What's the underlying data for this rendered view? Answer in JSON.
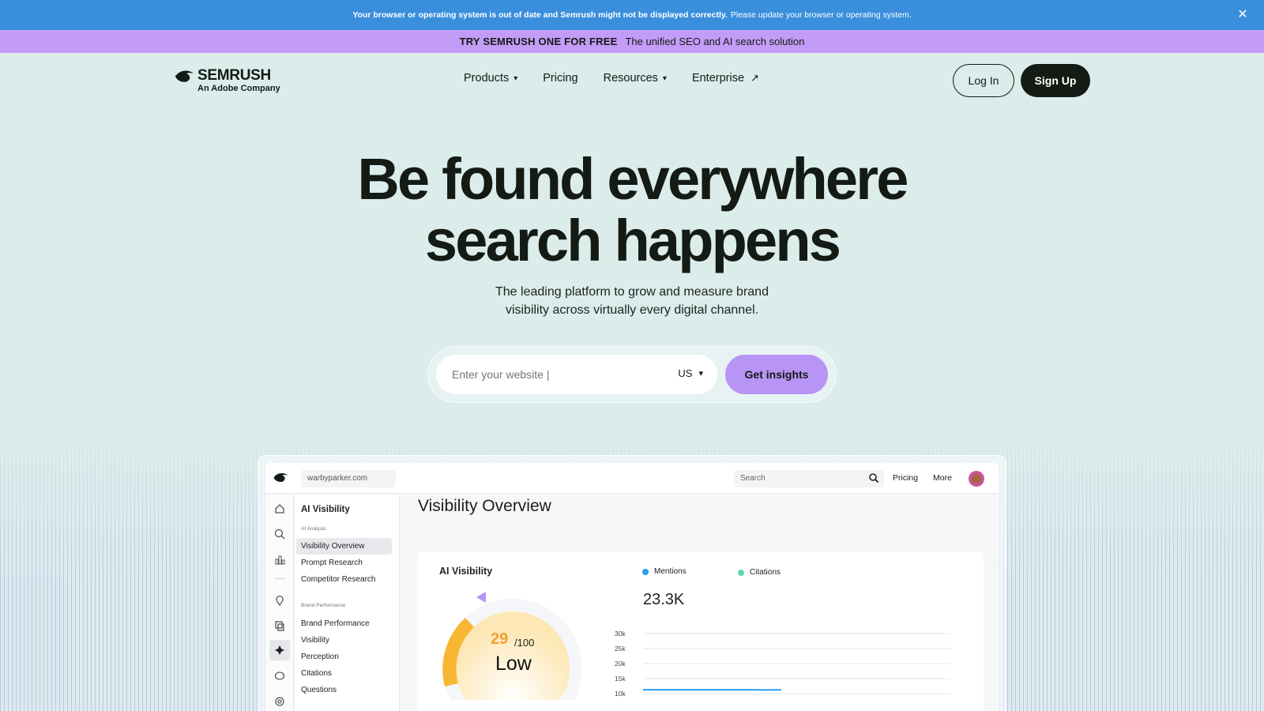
{
  "warning": {
    "bold_text": "Your browser or operating system is out of date and Semrush might not be displayed correctly.",
    "text": "Please update your browser or operating system.",
    "close_icon": "close-icon"
  },
  "promo": {
    "strong": "TRY SEMRUSH ONE FOR FREE",
    "text": "The unified SEO and AI search solution"
  },
  "header": {
    "logo_name": "SEMRUSH",
    "logo_sub": "An Adobe Company",
    "nav": [
      "Products",
      "Pricing",
      "Resources",
      "Enterprise"
    ],
    "login": "Log In",
    "signup": "Sign Up"
  },
  "hero": {
    "title_line1": "Be found everywhere",
    "title_line2": "search happens",
    "subtitle_line1": "The leading platform to grow and measure brand",
    "subtitle_line2": "visibility across virtually every digital channel.",
    "input_placeholder": "Enter your website |",
    "country": "US",
    "cta": "Get insights"
  },
  "app": {
    "domain": "warbyparker.com",
    "search_placeholder": "Search",
    "pricing": "Pricing",
    "more": "More",
    "sidebar": {
      "title": "AI Visibility",
      "section1": "AI Analysis",
      "section1_items": [
        "Visibility Overview",
        "Prompt Research",
        "Competitor Research"
      ],
      "section2": "Brand Performance",
      "section2_items": [
        "Brand Performance",
        "Visibility",
        "Perception",
        "Citations",
        "Questions"
      ]
    },
    "page_title": "Visibility Overview",
    "card": {
      "title": "AI Visibility",
      "score": "29",
      "score_max": "/100",
      "score_label": "Low",
      "legend": [
        "Mentions",
        "Citations"
      ],
      "mentions_value": "23.3K"
    },
    "colors": {
      "mentions": "#2d9cec",
      "citations": "#5fd3b6",
      "gauge": "#f7b733"
    }
  },
  "chart_data": {
    "type": "line",
    "y_ticks": [
      "30k",
      "25k",
      "20k",
      "15k",
      "10k"
    ],
    "ylim": [
      10000,
      30000
    ],
    "series": [
      {
        "name": "Mentions",
        "values": [
          11300,
          11300,
          11300,
          11300,
          11300,
          11300,
          11300,
          11300,
          11200,
          11300
        ]
      }
    ]
  }
}
